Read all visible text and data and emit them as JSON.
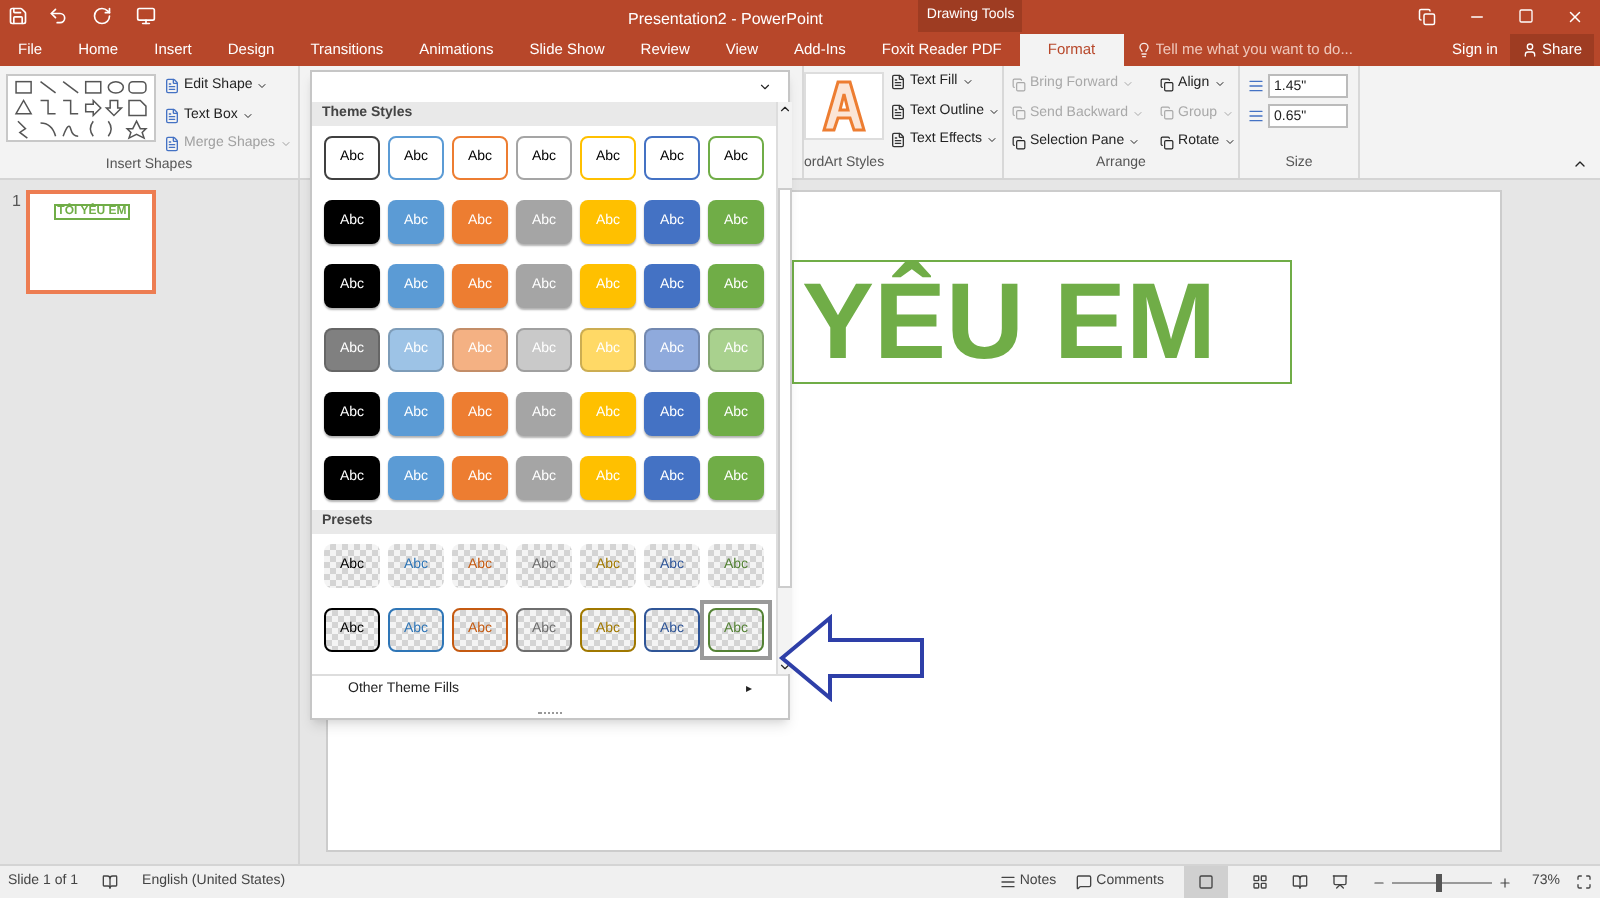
{
  "window": {
    "title": "Presentation2 - PowerPoint",
    "context_label": "Drawing Tools"
  },
  "tabs": [
    {
      "label": "File",
      "selected": false
    },
    {
      "label": "Home",
      "selected": false
    },
    {
      "label": "Insert",
      "selected": false
    },
    {
      "label": "Design",
      "selected": false
    },
    {
      "label": "Transitions",
      "selected": false
    },
    {
      "label": "Animations",
      "selected": false
    },
    {
      "label": "Slide Show",
      "selected": false
    },
    {
      "label": "Review",
      "selected": false
    },
    {
      "label": "View",
      "selected": false
    },
    {
      "label": "Add-Ins",
      "selected": false
    },
    {
      "label": "Foxit Reader PDF",
      "selected": false
    },
    {
      "label": "Format",
      "selected": true
    }
  ],
  "tell_me": {
    "placeholder": "Tell me what you want to do..."
  },
  "account": {
    "sign_in": "Sign in",
    "share": "Share"
  },
  "insert_shapes": {
    "buttons": [
      {
        "label": "Edit Shape",
        "disabled": false
      },
      {
        "label": "Text Box",
        "disabled": false
      },
      {
        "label": "Merge Shapes",
        "disabled": true
      }
    ],
    "group_label": "Insert Shapes"
  },
  "wordart": {
    "buttons": [
      {
        "label": "Text Fill"
      },
      {
        "label": "Text Outline"
      },
      {
        "label": "Text Effects"
      }
    ],
    "group_label": "ordArt Styles"
  },
  "arrange": {
    "buttons": [
      {
        "label": "Bring Forward",
        "disabled": true
      },
      {
        "label": "Align",
        "disabled": false
      },
      {
        "label": "Send Backward",
        "disabled": true
      },
      {
        "label": "Group",
        "disabled": true
      },
      {
        "label": "Selection Pane",
        "disabled": false
      },
      {
        "label": "Rotate",
        "disabled": false
      }
    ],
    "group_label": "Arrange"
  },
  "size": {
    "height": "1.45\"",
    "width": "0.65\"",
    "group_label": "Size"
  },
  "gallery": {
    "theme_header": "Theme Styles",
    "presets_header": "Presets",
    "footer": "Other Theme Fills",
    "footer_arrow": "▸",
    "theme_rows": [
      {
        "kind": "outline",
        "swatches": [
          {
            "label": "Abc",
            "color": "#404040",
            "selected": false
          },
          {
            "label": "Abc",
            "color": "#5b9bd5",
            "selected": false
          },
          {
            "label": "Abc",
            "color": "#ed7d31",
            "selected": false
          },
          {
            "label": "Abc",
            "color": "#a5a5a5",
            "selected": false
          },
          {
            "label": "Abc",
            "color": "#ffc000",
            "selected": false
          },
          {
            "label": "Abc",
            "color": "#4472c4",
            "selected": false
          },
          {
            "label": "Abc",
            "color": "#70ad47",
            "selected": false
          }
        ]
      },
      {
        "kind": "fill",
        "swatches": [
          {
            "label": "Abc",
            "color": "#000000",
            "selected": false
          },
          {
            "label": "Abc",
            "color": "#5b9bd5",
            "selected": false
          },
          {
            "label": "Abc",
            "color": "#ed7d31",
            "selected": false
          },
          {
            "label": "Abc",
            "color": "#a5a5a5",
            "selected": false
          },
          {
            "label": "Abc",
            "color": "#ffc000",
            "selected": false
          },
          {
            "label": "Abc",
            "color": "#4472c4",
            "selected": false
          },
          {
            "label": "Abc",
            "color": "#70ad47",
            "selected": false
          }
        ]
      },
      {
        "kind": "fill",
        "swatches": [
          {
            "label": "Abc",
            "color": "#000000",
            "selected": false
          },
          {
            "label": "Abc",
            "color": "#5b9bd5",
            "selected": false
          },
          {
            "label": "Abc",
            "color": "#ed7d31",
            "selected": false
          },
          {
            "label": "Abc",
            "color": "#a5a5a5",
            "selected": false
          },
          {
            "label": "Abc",
            "color": "#ffc000",
            "selected": false
          },
          {
            "label": "Abc",
            "color": "#4472c4",
            "selected": false
          },
          {
            "label": "Abc",
            "color": "#70ad47",
            "selected": false
          }
        ]
      },
      {
        "kind": "light",
        "swatches": [
          {
            "label": "Abc",
            "color": "#808080",
            "selected": false
          },
          {
            "label": "Abc",
            "color": "#9dc3e6",
            "selected": false
          },
          {
            "label": "Abc",
            "color": "#f4b183",
            "selected": false
          },
          {
            "label": "Abc",
            "color": "#c9c9c9",
            "selected": false
          },
          {
            "label": "Abc",
            "color": "#ffd966",
            "selected": false
          },
          {
            "label": "Abc",
            "color": "#8faadc",
            "selected": false
          },
          {
            "label": "Abc",
            "color": "#a9d18e",
            "selected": false
          }
        ]
      },
      {
        "kind": "fill",
        "swatches": [
          {
            "label": "Abc",
            "color": "#000000",
            "selected": false
          },
          {
            "label": "Abc",
            "color": "#5b9bd5",
            "selected": false
          },
          {
            "label": "Abc",
            "color": "#ed7d31",
            "selected": false
          },
          {
            "label": "Abc",
            "color": "#a5a5a5",
            "selected": false
          },
          {
            "label": "Abc",
            "color": "#ffc000",
            "selected": false
          },
          {
            "label": "Abc",
            "color": "#4472c4",
            "selected": false
          },
          {
            "label": "Abc",
            "color": "#70ad47",
            "selected": false
          }
        ]
      },
      {
        "kind": "fill",
        "swatches": [
          {
            "label": "Abc",
            "color": "#000000",
            "selected": false
          },
          {
            "label": "Abc",
            "color": "#5b9bd5",
            "selected": false
          },
          {
            "label": "Abc",
            "color": "#ed7d31",
            "selected": false
          },
          {
            "label": "Abc",
            "color": "#a5a5a5",
            "selected": false
          },
          {
            "label": "Abc",
            "color": "#ffc000",
            "selected": false
          },
          {
            "label": "Abc",
            "color": "#4472c4",
            "selected": false
          },
          {
            "label": "Abc",
            "color": "#70ad47",
            "selected": false
          }
        ]
      }
    ],
    "preset_rows": [
      {
        "kind": "transparent",
        "swatches": [
          {
            "label": "Abc",
            "color": "#000000",
            "selected": false
          },
          {
            "label": "Abc",
            "color": "#2e75b6",
            "selected": false
          },
          {
            "label": "Abc",
            "color": "#c55a11",
            "selected": false
          },
          {
            "label": "Abc",
            "color": "#6e6e6e",
            "selected": false
          },
          {
            "label": "Abc",
            "color": "#a07800",
            "selected": false
          },
          {
            "label": "Abc",
            "color": "#2f5597",
            "selected": false
          },
          {
            "label": "Abc",
            "color": "#548235",
            "selected": false
          }
        ]
      },
      {
        "kind": "transparent-outline",
        "swatches": [
          {
            "label": "Abc",
            "color": "#000000",
            "selected": false
          },
          {
            "label": "Abc",
            "color": "#2e75b6",
            "selected": false
          },
          {
            "label": "Abc",
            "color": "#c55a11",
            "selected": false
          },
          {
            "label": "Abc",
            "color": "#6e6e6e",
            "selected": false
          },
          {
            "label": "Abc",
            "color": "#a07800",
            "selected": false
          },
          {
            "label": "Abc",
            "color": "#2f5597",
            "selected": false
          },
          {
            "label": "Abc",
            "color": "#548235",
            "selected": true
          }
        ]
      }
    ]
  },
  "thumbnails": [
    {
      "number": "1",
      "text": "TÔI YÊU EM",
      "selected": true
    }
  ],
  "slide": {
    "text": "YÊU EM"
  },
  "status_bar": {
    "slide": "Slide 1 of 1",
    "language": "English (United States)",
    "notes": "Notes",
    "comments": "Comments",
    "zoom": "73%",
    "zoom_slider": {
      "level": 0.45
    }
  }
}
